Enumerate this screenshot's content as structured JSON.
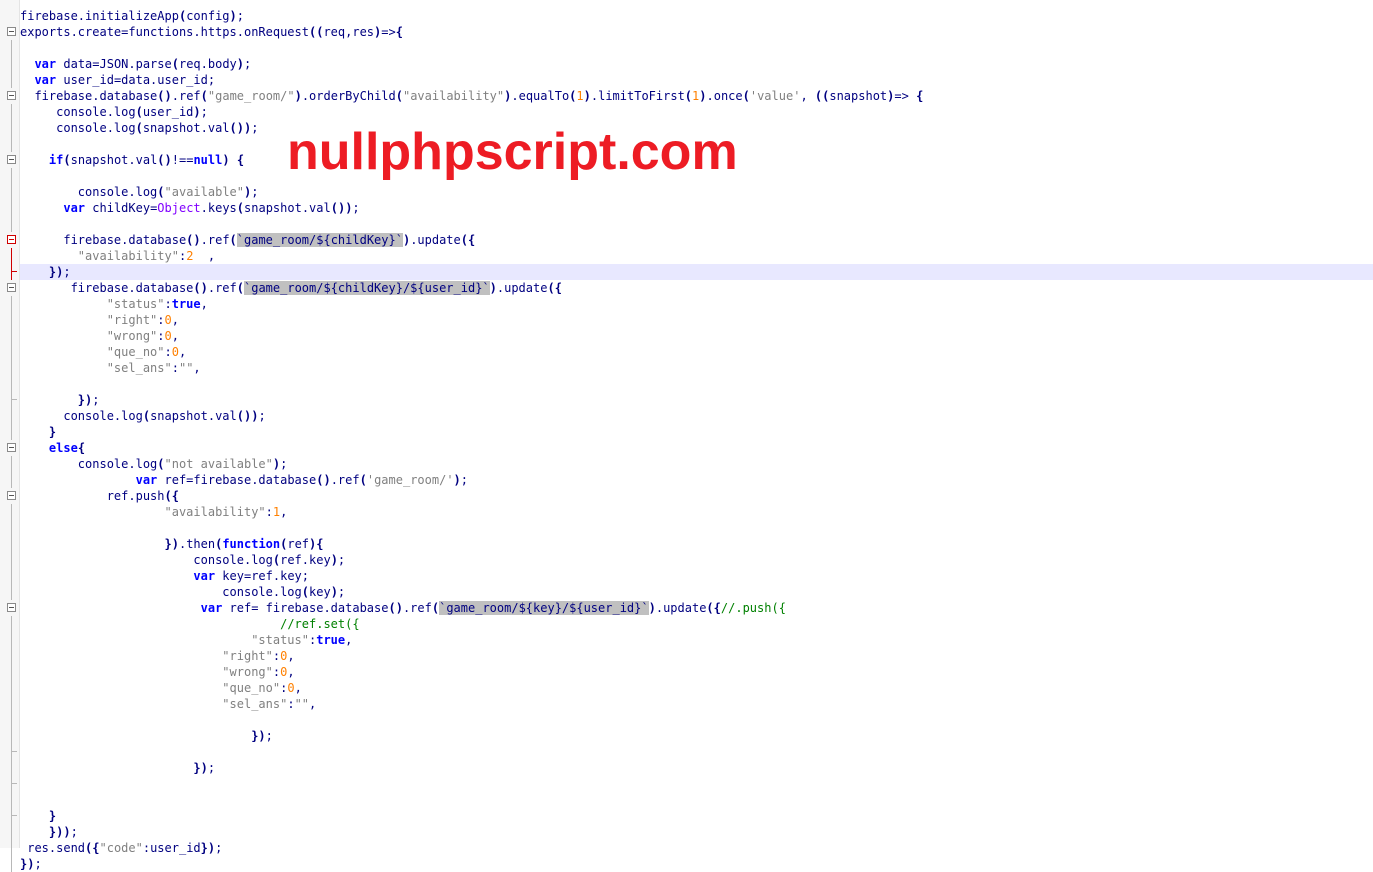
{
  "editor": {
    "lines": [
      "firebase.initializeApp(config);",
      "exports.create=functions.https.onRequest((req,res)=>{",
      "",
      "  var data=JSON.parse(req.body);",
      "  var user_id=data.user_id;",
      "  firebase.database().ref(\"game_room/\").orderByChild(\"availability\").equalTo(1).limitToFirst(1).once('value', ((snapshot)=> {",
      "     console.log(user_id);",
      "     console.log(snapshot.val());",
      "",
      "    if(snapshot.val()!==null) {",
      "",
      "        console.log(\"available\");",
      "      var childKey=Object.keys(snapshot.val());",
      "",
      "      firebase.database().ref(`game_room/${childKey}`).update({",
      "        \"availability\":2  ,",
      "    });",
      "       firebase.database().ref(`game_room/${childKey}/${user_id}`).update({",
      "            \"status\":true,",
      "            \"right\":0,",
      "            \"wrong\":0,",
      "            \"que_no\":0,",
      "            \"sel_ans\":\"\",",
      "",
      "        });",
      "      console.log(snapshot.val());",
      "    }",
      "    else{",
      "        console.log(\"not available\");",
      "                var ref=firebase.database().ref('game_room/');",
      "            ref.push({",
      "                    \"availability\":1,",
      "",
      "                    }).then(function(ref){",
      "                        console.log(ref.key);",
      "                        var key=ref.key;",
      "                            console.log(key);",
      "                         var ref= firebase.database().ref(`game_room/${key}/${user_id}`).update({//.push({",
      "                                    //ref.set({",
      "                                \"status\":true,",
      "                            \"right\":0,",
      "                            \"wrong\":0,",
      "                            \"que_no\":0,",
      "                            \"sel_ans\":\"\",",
      "",
      "                                });",
      "",
      "                        });",
      "",
      "",
      "    }",
      "    }));",
      " res.send({\"code\":user_id});",
      "});"
    ]
  },
  "watermark": {
    "text": "nullphpscript.com"
  },
  "colors": {
    "background": "#ffffff",
    "text": "#000080",
    "keyword": "#0000ff",
    "string": "#808080",
    "number": "#ff8000",
    "comment": "#008000",
    "watermark": "#ed1c24",
    "current_line": "#e8e8ff"
  }
}
